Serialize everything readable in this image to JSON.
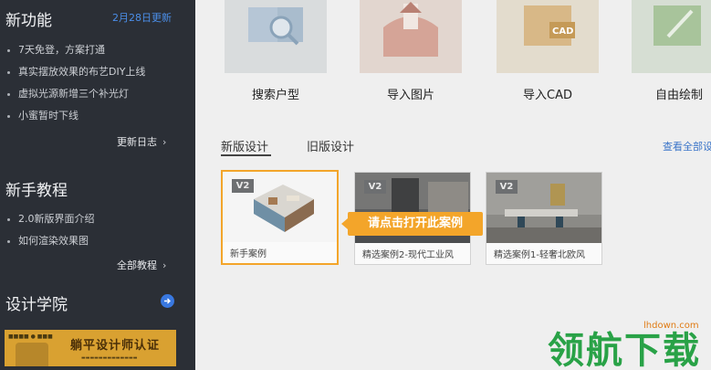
{
  "sidebar": {
    "new_features": {
      "title": "新功能",
      "date": "2月28日更新",
      "items": [
        "7天免登，方案打通",
        "真实摆放效果的布艺DIY上线",
        "虚拟光源新增三个补光灯",
        "小蜜暂时下线"
      ],
      "more": "更新日志",
      "more_icon": "chevron-right-icon"
    },
    "tutorials": {
      "title": "新手教程",
      "items": [
        "2.0新版界面介绍",
        "如何渲染效果图"
      ],
      "more": "全部教程",
      "more_icon": "chevron-right-icon"
    },
    "academy": {
      "title": "设计学院",
      "icon": "arrow-right-circle-icon"
    },
    "banner": {
      "title": "躺平设计师认证"
    }
  },
  "main": {
    "tiles": [
      {
        "label": "搜索户型",
        "icon": "search-floorplan-icon",
        "color": "#d8dde0"
      },
      {
        "label": "导入图片",
        "icon": "import-image-icon",
        "color": "#e2d6cf"
      },
      {
        "label": "导入CAD",
        "icon": "cad-icon",
        "color": "#e3dccd"
      },
      {
        "label": "自由绘制",
        "icon": "draw-icon",
        "color": "#d6ded3"
      }
    ],
    "tabs": [
      "新版设计",
      "旧版设计"
    ],
    "view_all": "查看全部设",
    "cards": [
      {
        "badge": "V2",
        "caption": "新手案例",
        "selected": true
      },
      {
        "badge": "V2",
        "caption": "精选案例2-现代工业风",
        "selected": false
      },
      {
        "badge": "V2",
        "caption": "精选案例1-轻奢北欧风",
        "selected": false
      }
    ],
    "tooltip": "请点击打开此案例"
  },
  "watermark": {
    "text": "领航下载",
    "site": "lhdown.com"
  },
  "colors": {
    "accent_blue": "#3b75c9",
    "highlight_orange": "#f3a52a",
    "sidebar_bg": "#2b2f36"
  }
}
